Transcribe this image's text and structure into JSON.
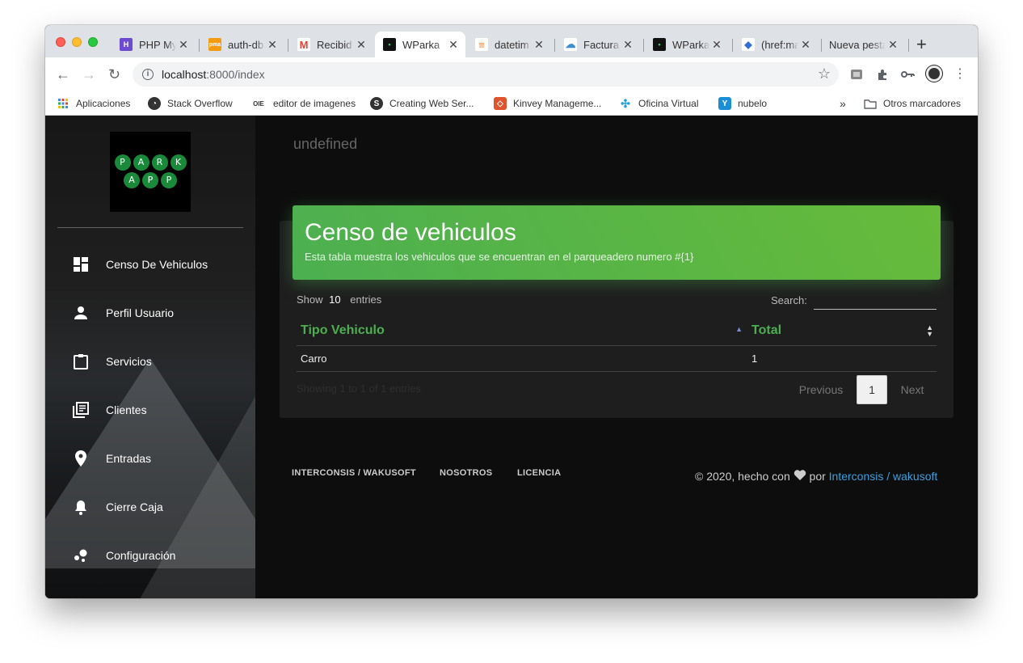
{
  "browser": {
    "tabs": [
      {
        "title": "PHP My",
        "favicon_color": "#6c4bd1",
        "favicon_text": "H"
      },
      {
        "title": "auth-db",
        "favicon_color": "#f39c12",
        "favicon_text": "pma"
      },
      {
        "title": "Recibid",
        "favicon_color": "#ea4335",
        "favicon_text": "M"
      },
      {
        "title": "WParka",
        "favicon_color": "#111111",
        "favicon_text": "▪",
        "active": true
      },
      {
        "title": "datetim",
        "favicon_color": "#f48024",
        "favicon_text": "≡"
      },
      {
        "title": "Factura",
        "favicon_color": "#3b8ed0",
        "favicon_text": "☁"
      },
      {
        "title": "WParka",
        "favicon_color": "#111111",
        "favicon_text": "▪"
      },
      {
        "title": "(href:ma",
        "favicon_color": "#2f6fd8",
        "favicon_text": "◆"
      },
      {
        "title": "Nueva pesta",
        "favicon_color": "",
        "favicon_text": ""
      }
    ],
    "tab_close": "✕",
    "new_tab": "+",
    "url_host": "localhost",
    "url_rest": ":8000/index",
    "bookmarks": [
      {
        "label": "Aplicaciones",
        "icon": "apps-icon"
      },
      {
        "label": "Stack Overflow",
        "icon": "stackoverflow-icon"
      },
      {
        "label": "editor de imagenes",
        "icon": "editor-icon"
      },
      {
        "label": "Creating Web Ser...",
        "icon": "web-icon"
      },
      {
        "label": "Kinvey Manageme...",
        "icon": "kinvey-icon"
      },
      {
        "label": "Oficina Virtual",
        "icon": "oficina-icon"
      },
      {
        "label": "nubelo",
        "icon": "nubelo-icon"
      }
    ],
    "bookmarks_overflow": "»",
    "other_bookmarks": "Otros marcadores"
  },
  "sidebar": {
    "logo_row1": [
      "P",
      "A",
      "R",
      "K"
    ],
    "logo_row2": [
      "A",
      "P",
      "P"
    ],
    "items": [
      {
        "label": "Censo De Vehiculos",
        "icon": "dashboard-icon"
      },
      {
        "label": "Perfil Usuario",
        "icon": "person-icon"
      },
      {
        "label": "Servicios",
        "icon": "clipboard-icon"
      },
      {
        "label": "Clientes",
        "icon": "library-books-icon"
      },
      {
        "label": "Entradas",
        "icon": "location-pin-icon"
      },
      {
        "label": "Cierre Caja",
        "icon": "bell-icon"
      },
      {
        "label": "Configuración",
        "icon": "bubble-chart-icon"
      }
    ]
  },
  "main": {
    "breadcrumb": "undefined",
    "card_title": "Censo de vehiculos",
    "card_subtitle": "Esta tabla muestra los vehiculos que se encuentran en el parqueadero numero #{1}",
    "show_label": "Show",
    "show_value": "10",
    "entries_label": "entries",
    "search_label": "Search:",
    "columns": [
      "Tipo Vehiculo",
      "Total"
    ],
    "rows": [
      [
        "Carro",
        "1"
      ]
    ],
    "info": "Showing 1 to 1 of 1 entries",
    "pagination": {
      "previous": "Previous",
      "current": "1",
      "next": "Next"
    }
  },
  "footer": {
    "links": [
      "INTERCONSIS / WAKUSOFT",
      "NOSOTROS",
      "LICENCIA"
    ],
    "copyright_prefix": "© 2020, hecho con",
    "copyright_por": "por",
    "copyright_link": "Interconsis / wakusoft"
  },
  "colors": {
    "accent_green": "#4caf50",
    "link_blue": "#3aa0e0"
  }
}
